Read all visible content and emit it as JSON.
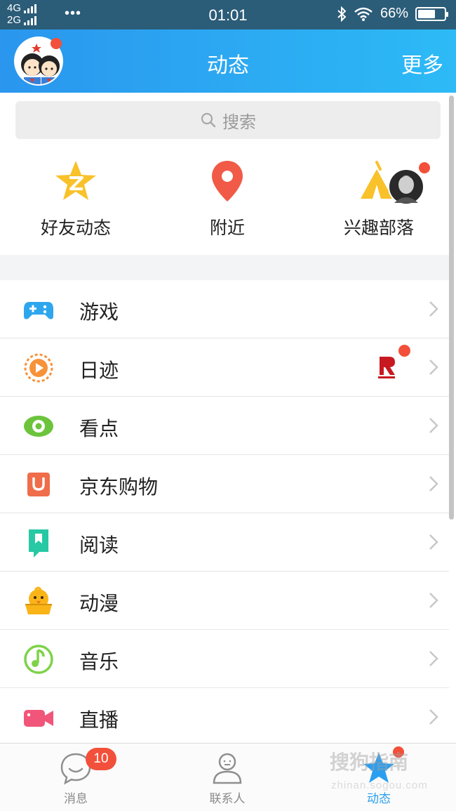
{
  "status_bar": {
    "network_top": "4G",
    "network_bottom": "2G",
    "more": "•••",
    "time": "01:01",
    "battery": "66%",
    "battery_level": 0.66
  },
  "header": {
    "title": "动态",
    "more_label": "更多"
  },
  "search": {
    "placeholder": "搜索"
  },
  "shortcuts": [
    {
      "label": "好友动态",
      "icon": "qzone-star-icon"
    },
    {
      "label": "附近",
      "icon": "location-pin-icon"
    },
    {
      "label": "兴趣部落",
      "icon": "tribe-tent-icon"
    }
  ],
  "list": [
    {
      "label": "游戏",
      "icon": "gamepad-icon",
      "color": "#2ea6ee"
    },
    {
      "label": "日迹",
      "icon": "play-circle-icon",
      "color": "#f7923a"
    },
    {
      "label": "看点",
      "icon": "eye-icon",
      "color": "#6cc43c"
    },
    {
      "label": "京东购物",
      "icon": "shopping-bag-icon",
      "color": "#ef6d4a"
    },
    {
      "label": "阅读",
      "icon": "bookmark-book-icon",
      "color": "#26c9a4"
    },
    {
      "label": "动漫",
      "icon": "chick-icon",
      "color": "#f9b418"
    },
    {
      "label": "音乐",
      "icon": "music-note-icon",
      "color": "#7ed248"
    },
    {
      "label": "直播",
      "icon": "video-camera-icon",
      "color": "#f2557a"
    }
  ],
  "bottom_nav": {
    "tabs": [
      {
        "label": "消息",
        "icon": "chat-bubble-icon"
      },
      {
        "label": "联系人",
        "icon": "person-icon"
      },
      {
        "label": "动态",
        "icon": "star-icon"
      }
    ],
    "messages_badge": "10"
  },
  "watermark": {
    "text": "搜狗指南",
    "url": "zhinan.sogou.com"
  },
  "colors": {
    "header_start": "#2a96ee",
    "header_end": "#2dbaf6",
    "accent": "#2a9ff0",
    "notification_dot": "#f2503a"
  }
}
